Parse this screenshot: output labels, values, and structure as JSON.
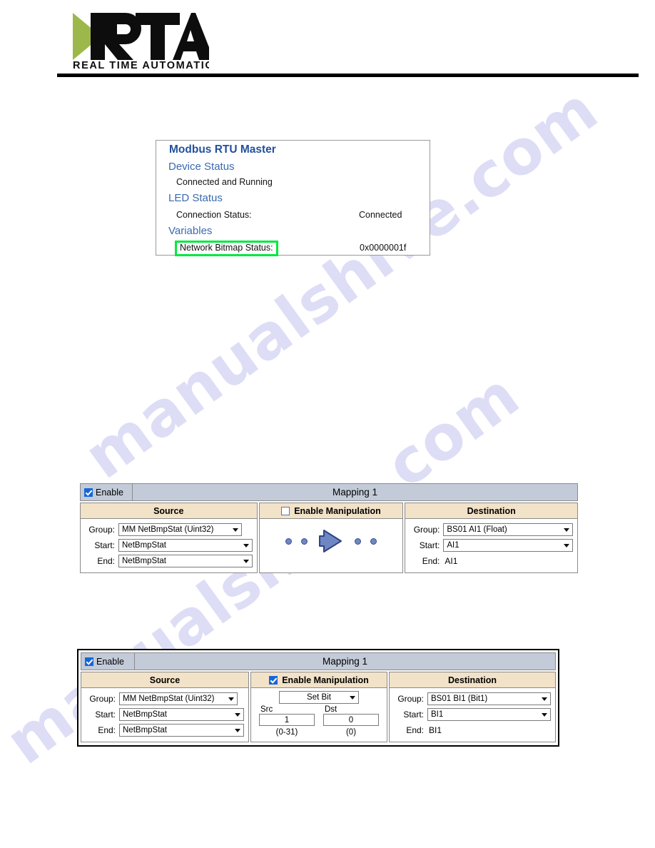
{
  "header": {
    "logo_text": "RTA",
    "logo_tagline": "REAL TIME AUTOMATION"
  },
  "watermark": {
    "text": "manualshive.com"
  },
  "status_panel": {
    "title": "Modbus RTU Master",
    "device_status_heading": "Device Status",
    "device_status_value": "Connected and Running",
    "led_status_heading": "LED Status",
    "connection_status_label": "Connection Status:",
    "connection_status_value": "Connected",
    "variables_heading": "Variables",
    "network_bitmap_label": "Network Bitmap Status:",
    "network_bitmap_value": "0x0000001f",
    "highlight_color": "#00e83c",
    "heading_color": "#3a6ab0",
    "title_color": "#23509c"
  },
  "mapping_1": {
    "enable_label": "Enable",
    "enable_checked": true,
    "title": "Mapping 1",
    "source": {
      "header": "Source",
      "group_label": "Group:",
      "group_value": "MM NetBmpStat (Uint32)",
      "start_label": "Start:",
      "start_value": "NetBmpStat",
      "end_label": "End:",
      "end_value": "NetBmpStat"
    },
    "manipulation": {
      "header": "Enable Manipulation",
      "checked": false,
      "dot_count": 4,
      "arrow_icon": "right-arrow-icon"
    },
    "destination": {
      "header": "Destination",
      "group_label": "Group:",
      "group_value": "BS01 AI1 (Float)",
      "start_label": "Start:",
      "start_value": "AI1",
      "end_label": "End:",
      "end_value": "AI1"
    }
  },
  "mapping_2": {
    "enable_label": "Enable",
    "enable_checked": true,
    "title": "Mapping 1",
    "source": {
      "header": "Source",
      "group_label": "Group:",
      "group_value": "MM NetBmpStat (Uint32)",
      "start_label": "Start:",
      "start_value": "NetBmpStat",
      "end_label": "End:",
      "end_value": "NetBmpStat"
    },
    "manipulation": {
      "header": "Enable Manipulation",
      "checked": true,
      "operation_value": "Set Bit",
      "src_label": "Src",
      "src_value": "1",
      "src_range": "(0-31)",
      "dst_label": "Dst",
      "dst_value": "0",
      "dst_range": "(0)"
    },
    "destination": {
      "header": "Destination",
      "group_label": "Group:",
      "group_value": "BS01 BI1 (Bit1)",
      "start_label": "Start:",
      "start_value": "BI1",
      "end_label": "End:",
      "end_value": "BI1"
    }
  },
  "theme": {
    "title_bar_bg": "#c3cbd9",
    "col_head_bg": "#f2e2c8",
    "logo_green": "#9db84a",
    "arrow_blue": "#6f86c4",
    "watermark_color": "#c9c9f2"
  }
}
